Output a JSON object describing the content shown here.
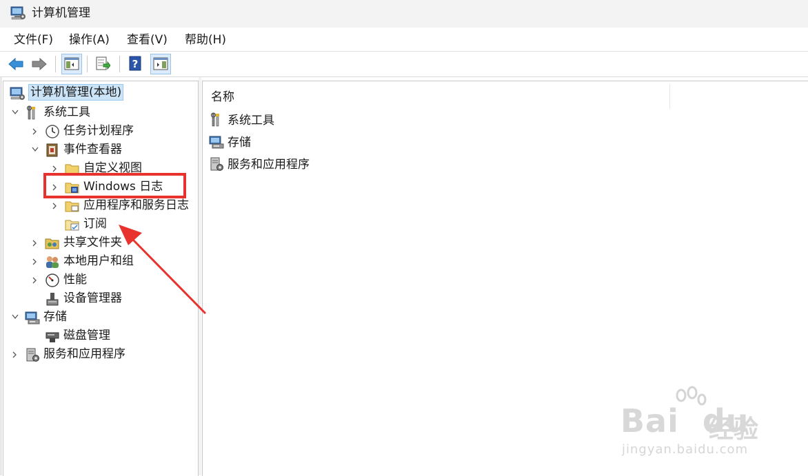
{
  "window": {
    "title": "计算机管理",
    "icon": "computer-management-icon"
  },
  "menu": [
    {
      "label": "文件(F)"
    },
    {
      "label": "操作(A)"
    },
    {
      "label": "查看(V)"
    },
    {
      "label": "帮助(H)"
    }
  ],
  "toolbar": {
    "buttons": [
      "back-arrow-icon",
      "forward-arrow-icon",
      "show-hide-console-tree-icon",
      "export-list-icon",
      "help-icon",
      "show-hide-action-pane-icon"
    ]
  },
  "tree": {
    "root": "计算机管理(本地)",
    "system_tools": "系统工具",
    "task_scheduler": "任务计划程序",
    "event_viewer": "事件查看器",
    "custom_views": "自定义视图",
    "windows_logs": "Windows 日志",
    "app_service_logs": "应用程序和服务日志",
    "subscriptions": "订阅",
    "shared_folders": "共享文件夹",
    "local_users_groups": "本地用户和组",
    "performance": "性能",
    "device_manager": "设备管理器",
    "storage": "存储",
    "disk_management": "磁盘管理",
    "services_apps": "服务和应用程序"
  },
  "list": {
    "column_name": "名称",
    "items": [
      {
        "label": "系统工具",
        "icon": "tools-icon"
      },
      {
        "label": "存储",
        "icon": "storage-icon"
      },
      {
        "label": "服务和应用程序",
        "icon": "services-icon"
      }
    ]
  },
  "annotation": {
    "highlight_color": "#e8322d"
  },
  "watermark": {
    "brand": "Bai",
    "brand_suffix": "du",
    "cn": "经验",
    "url": "jingyan.baidu.com"
  }
}
